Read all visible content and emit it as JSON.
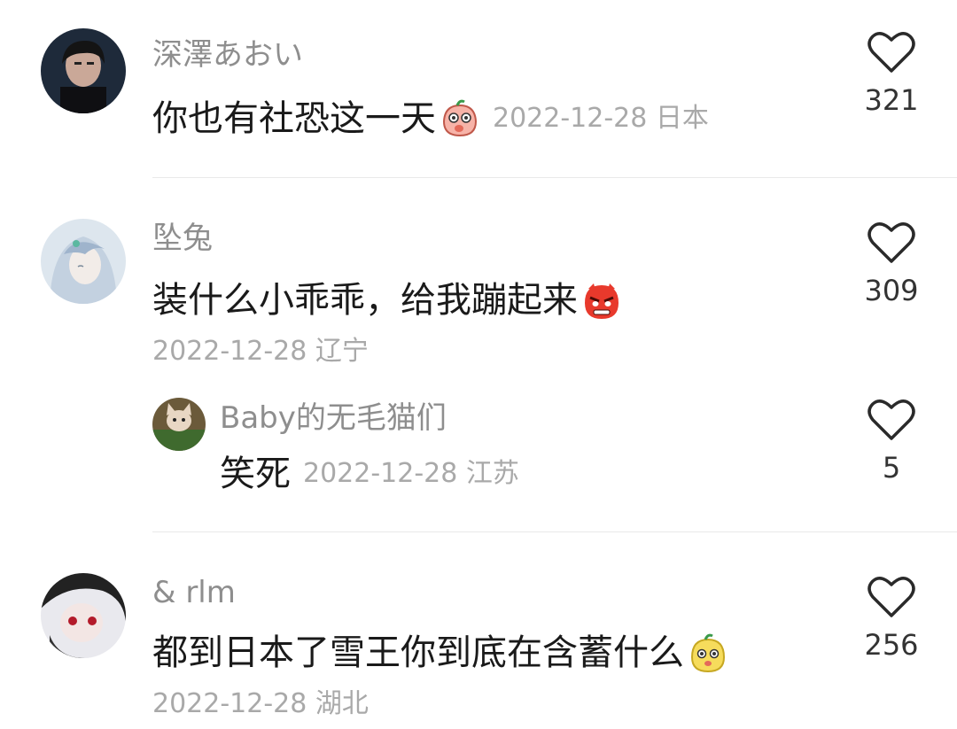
{
  "comments": [
    {
      "username": "深澤あおい",
      "text": "你也有社恐这一天",
      "emoji": "peach-shy-emoji",
      "meta": "2022-12-28 日本",
      "likes": "321"
    },
    {
      "username": "坠兔",
      "text": "装什么小乖乖，给我蹦起来",
      "emoji": "angry-face-emoji",
      "meta": "2022-12-28 辽宁",
      "likes": "309",
      "reply": {
        "username": "Baby的无毛猫们",
        "text": "笑死",
        "meta": "2022-12-28 江苏",
        "likes": "5"
      }
    },
    {
      "username": "& rlm",
      "text": "都到日本了雪王你到底在含蓄什么",
      "emoji": "yellow-blob-emoji",
      "meta": "2022-12-28 湖北",
      "likes": "256"
    }
  ],
  "colors": {
    "username": "#8e8e8e",
    "text": "#1a1a1a",
    "meta": "#a9a9a9",
    "divider": "#e9e9e9"
  }
}
